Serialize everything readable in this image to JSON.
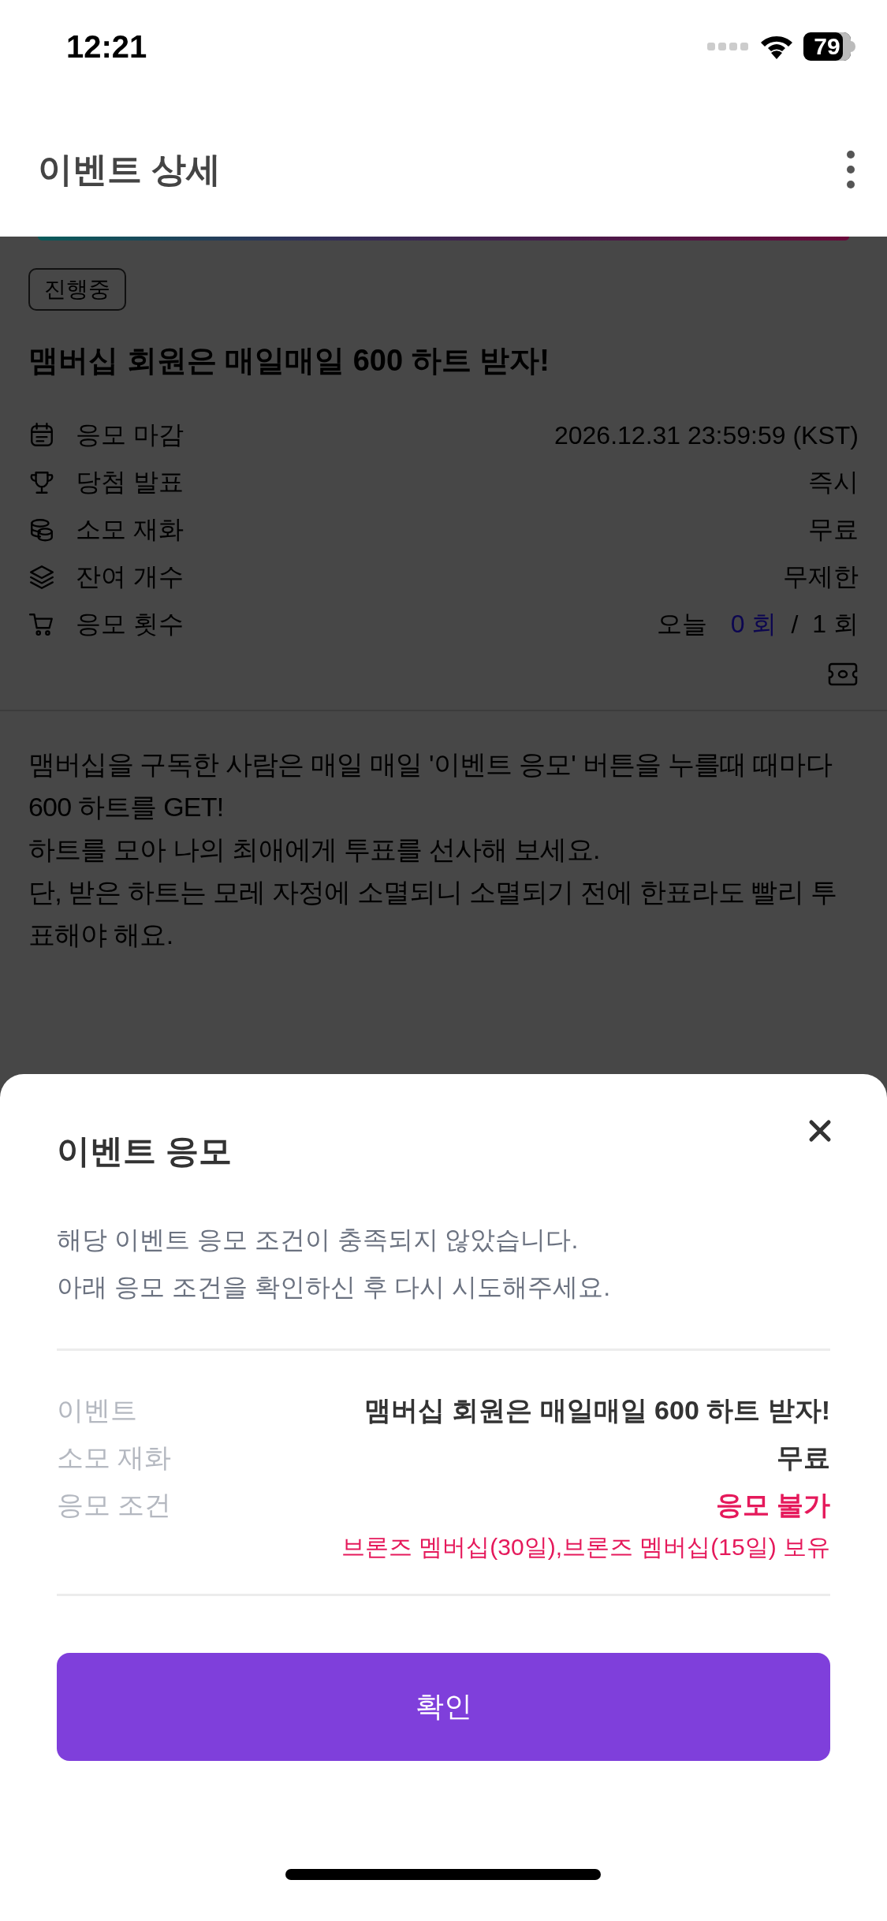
{
  "status_bar": {
    "time": "12:21",
    "battery": "79"
  },
  "header": {
    "title": "이벤트 상세"
  },
  "event": {
    "status": "진행중",
    "title": "맴버십 회원은 매일매일 600 하트 받자!",
    "info": [
      {
        "label": "응모 마감",
        "value": "2026.12.31 23:59:59 (KST)"
      },
      {
        "label": "당첨 발표",
        "value": "즉시"
      },
      {
        "label": "소모 재화",
        "value": "무료"
      },
      {
        "label": "잔여 개수",
        "value": "무제한"
      },
      {
        "label": "응모 횟수",
        "today_label": "오늘",
        "today_count": "0 회",
        "separator": "/",
        "limit": "1 회"
      }
    ],
    "description": [
      "맴버십을 구독한 사람은 매일 매일 '이벤트 응모' 버튼을 누를때 때마다 600 하트를 GET!",
      "하트를 모아 나의 최애에게 투표를 선사해 보세요.",
      "단, 받은 하트는 모레 자정에 소멸되니 소멸되기 전에 한표라도 빨리 투표해야 해요."
    ]
  },
  "sheet": {
    "title": "이벤트 응모",
    "message": [
      "해당 이벤트 응모 조건이 충족되지 않았습니다.",
      "아래 응모 조건을 확인하신 후 다시 시도해주세요."
    ],
    "rows": [
      {
        "kind": "normal",
        "label": "이벤트",
        "value": "맴버십 회원은 매일매일 600 하트 받자!"
      },
      {
        "kind": "normal",
        "label": "소모 재화",
        "value": "무료"
      },
      {
        "kind": "alert",
        "label": "응모 조건",
        "value": "응모 불가"
      }
    ],
    "note": "브론즈 멤버십(30일),브론즈 멤버십(15일) 보유",
    "button": "확인"
  }
}
